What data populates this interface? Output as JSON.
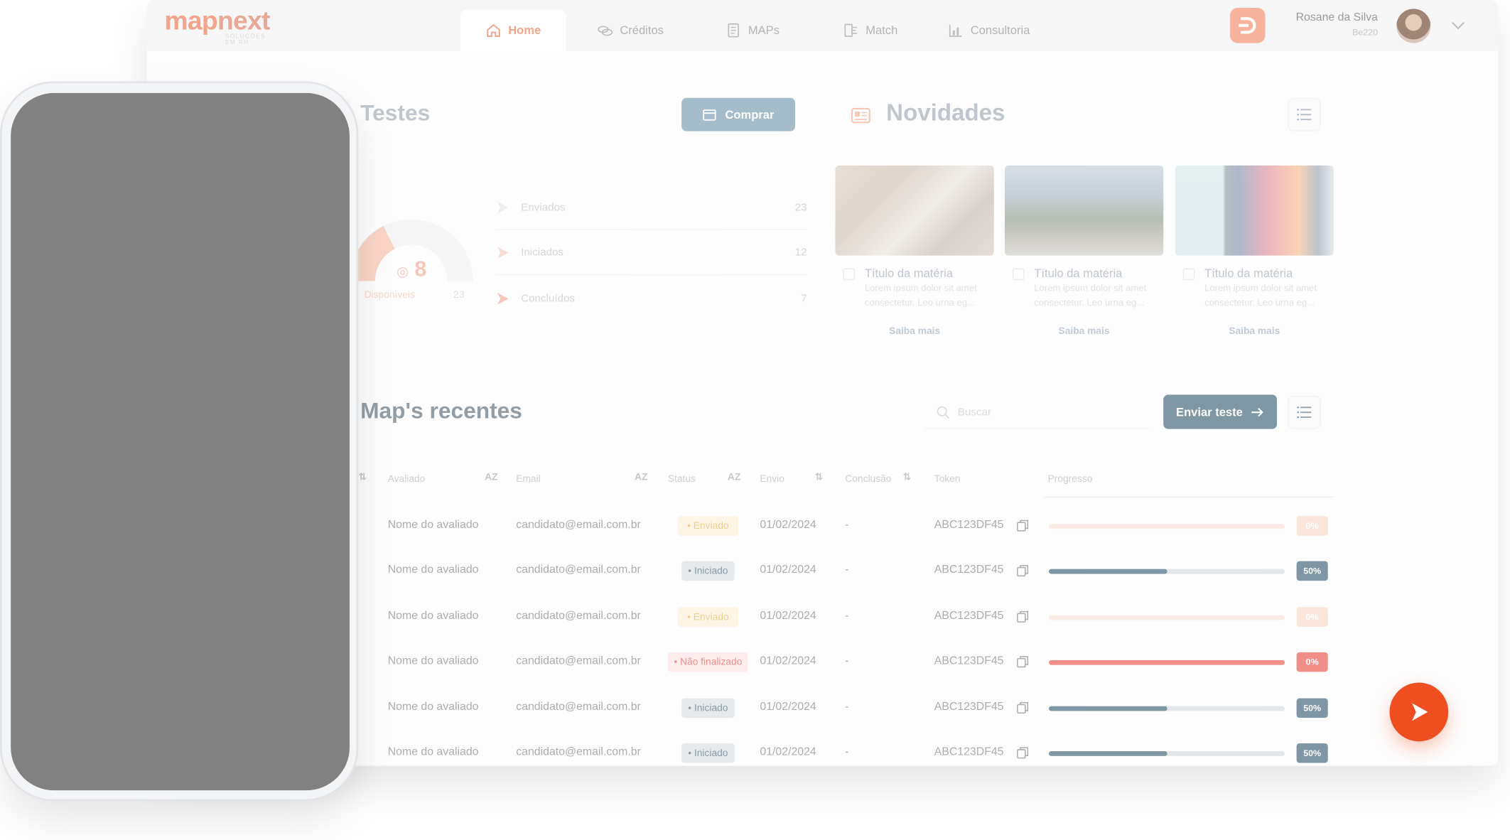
{
  "app": {
    "logo_part1": "map",
    "logo_part2": "next",
    "logo_sub": "SOLUÇÕES EM RH"
  },
  "nav": {
    "tabs": [
      {
        "label": "Home",
        "icon": "home-icon",
        "active": true
      },
      {
        "label": "Créditos",
        "icon": "coins-icon",
        "active": false
      },
      {
        "label": "MAPs",
        "icon": "document-icon",
        "active": false
      },
      {
        "label": "Match",
        "icon": "match-icon",
        "active": false
      },
      {
        "label": "Consultoria",
        "icon": "chart-icon",
        "active": false
      }
    ],
    "user_name": "Rosane da Silva",
    "user_code": "Be220"
  },
  "testes": {
    "title": "Testes",
    "buy_label": "Comprar",
    "available_count": "8",
    "available_label": "Disponíveis",
    "available_fraction": 0.35,
    "total": "23",
    "stats": [
      {
        "label": "Enviados",
        "value": "23"
      },
      {
        "label": "Iniciados",
        "value": "12"
      },
      {
        "label": "Concluídos",
        "value": "7"
      }
    ]
  },
  "novidades": {
    "title": "Novidades",
    "cards": [
      {
        "title": "Título da matéria",
        "body": "Lorem ipsum dolor sit amet consectetur. Leo urna eg...",
        "link": "Saiba mais"
      },
      {
        "title": "Título da matéria",
        "body": "Lorem ipsum dolor sit amet consectetur. Leo urna eg...",
        "link": "Saiba mais"
      },
      {
        "title": "Título da matéria",
        "body": "Lorem ipsum dolor sit amet consectetur. Leo urna eg...",
        "link": "Saiba mais"
      }
    ]
  },
  "recentes": {
    "title": "Map's recentes",
    "search_placeholder": "Buscar",
    "send_label": "Enviar teste",
    "columns": {
      "avaliado": "Avaliado",
      "email": "Email",
      "status": "Status",
      "envio": "Envio",
      "conclusao": "Conclusão",
      "token": "Token",
      "progresso": "Progresso"
    },
    "sort_az": "AZ",
    "rows": [
      {
        "name": "Nome do avaliado",
        "email": "candidato@email.com.br",
        "status": "• Enviado",
        "status_kind": "enviado",
        "envio": "01/02/2024",
        "conclusao": "-",
        "token": "ABC123DF45",
        "progress": 0,
        "progress_label": "0%"
      },
      {
        "name": "Nome do avaliado",
        "email": "candidato@email.com.br",
        "status": "• Iniciado",
        "status_kind": "iniciado",
        "envio": "01/02/2024",
        "conclusao": "-",
        "token": "ABC123DF45",
        "progress": 50,
        "progress_label": "50%"
      },
      {
        "name": "Nome do avaliado",
        "email": "candidato@email.com.br",
        "status": "• Enviado",
        "status_kind": "enviado",
        "envio": "01/02/2024",
        "conclusao": "-",
        "token": "ABC123DF45",
        "progress": 0,
        "progress_label": "0%"
      },
      {
        "name": "Nome do avaliado",
        "email": "candidato@email.com.br",
        "status": "• Não finalizado",
        "status_kind": "naofinalizado",
        "envio": "01/02/2024",
        "conclusao": "-",
        "token": "ABC123DF45",
        "progress": 0,
        "progress_label": "0%"
      },
      {
        "name": "Nome do avaliado",
        "email": "candidato@email.com.br",
        "status": "• Iniciado",
        "status_kind": "iniciado",
        "envio": "01/02/2024",
        "conclusao": "-",
        "token": "ABC123DF45",
        "progress": 50,
        "progress_label": "50%"
      },
      {
        "name": "Nome do avaliado",
        "email": "candidato@email.com.br",
        "status": "• Iniciado",
        "status_kind": "iniciado",
        "envio": "01/02/2024",
        "conclusao": "-",
        "token": "ABC123DF45",
        "progress": 50,
        "progress_label": "50%"
      }
    ]
  },
  "colors": {
    "brand_orange": "#ef4e21",
    "accent_navy": "#19445d",
    "danger_red": "#e8352a",
    "phone_screen": "#818181"
  }
}
